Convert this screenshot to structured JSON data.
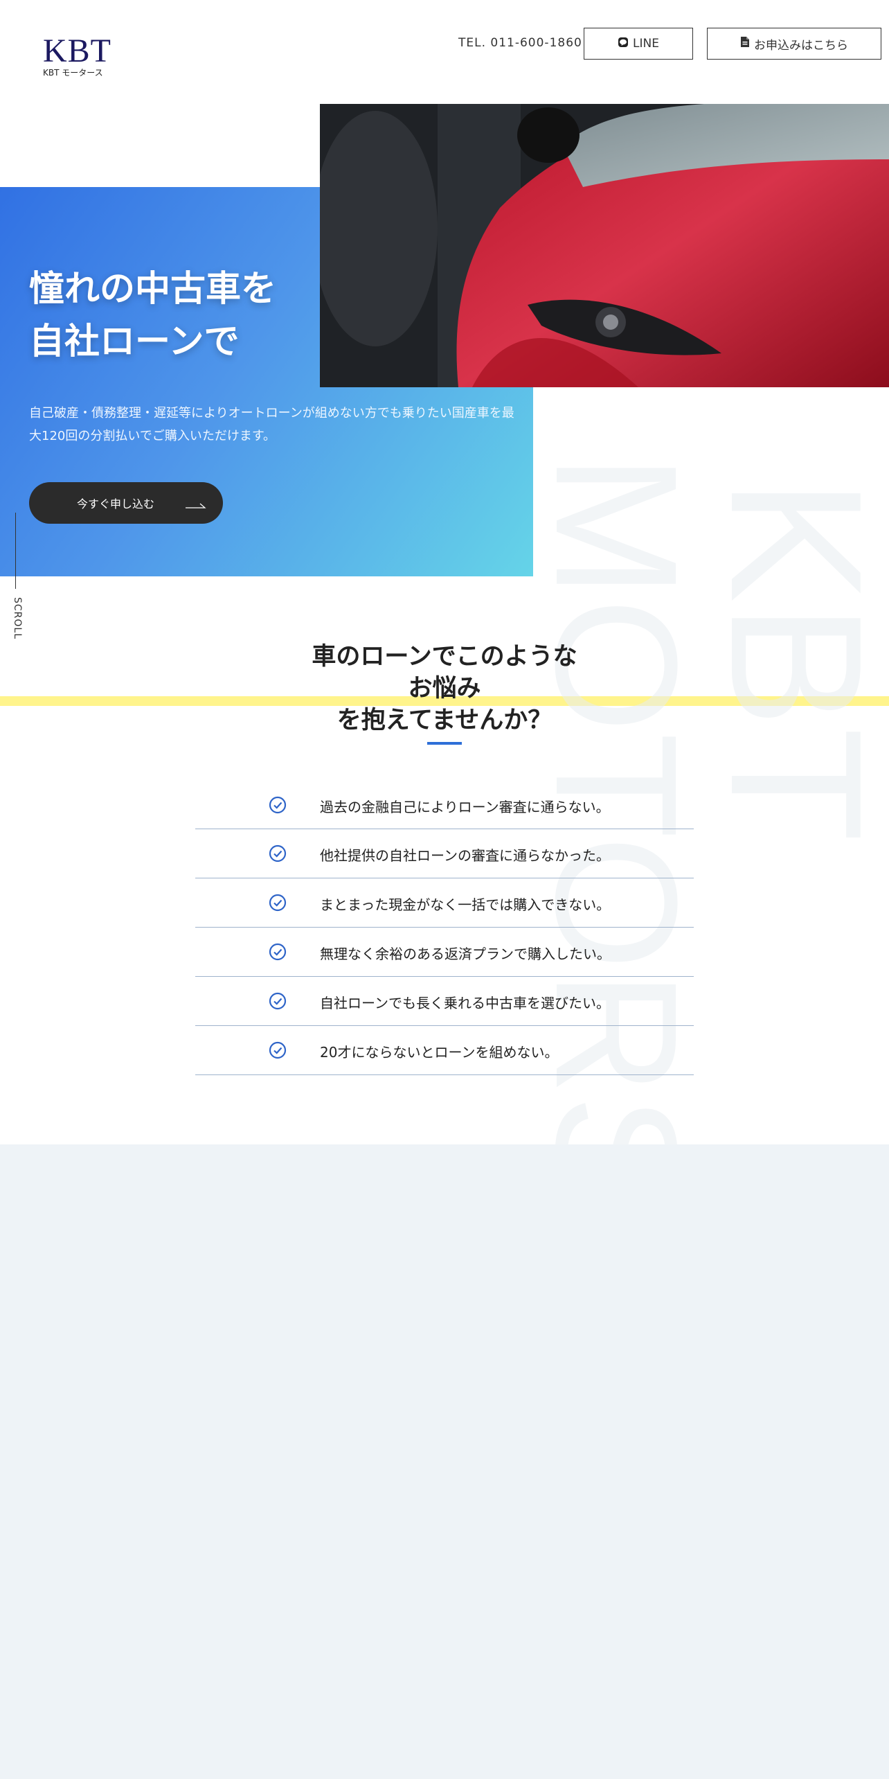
{
  "header": {
    "logo_text": "KBT",
    "logo_subtext": "KBT モータース",
    "tel": "TEL. 011-600-1860",
    "line_button": "LINE",
    "apply_button": "お申込みはこちら"
  },
  "hero": {
    "title_line1": "憧れの中古車を",
    "title_line2": "自社ローンで",
    "description": "自己破産・債務整理・遅延等によりオートローンが組めない方でも乗りたい国産車を最大120回の分割払いでご購入いただけます。",
    "cta": "今すぐ申し込む",
    "scroll_label": "SCROLL",
    "watermark_line1": "KBT",
    "watermark_line2": "MOTORS"
  },
  "concerns": {
    "title_line1": "車のローンでこのような",
    "title_highlight": "お悩み",
    "title_rest": "を抱えてませんか？",
    "items": [
      "過去の金融自己によりローン審査に通らない。",
      "他社提供の自社ローンの審査に通らなかった。",
      "まとまった現金がなく一括では購入できない。",
      "無理なく余裕のある返済プランで購入したい。",
      "自社ローンでも長く乗れる中古車を選びたい。",
      "20才にならないとローンを組めない。"
    ]
  },
  "colors": {
    "brand_navy": "#1b1960",
    "accent_blue": "#2e6fd8",
    "hero_gradient_start": "#3171e3",
    "hero_gradient_end": "#65d4e8",
    "highlight_yellow": "#fff48c",
    "section_bg": "#eef3f7"
  }
}
